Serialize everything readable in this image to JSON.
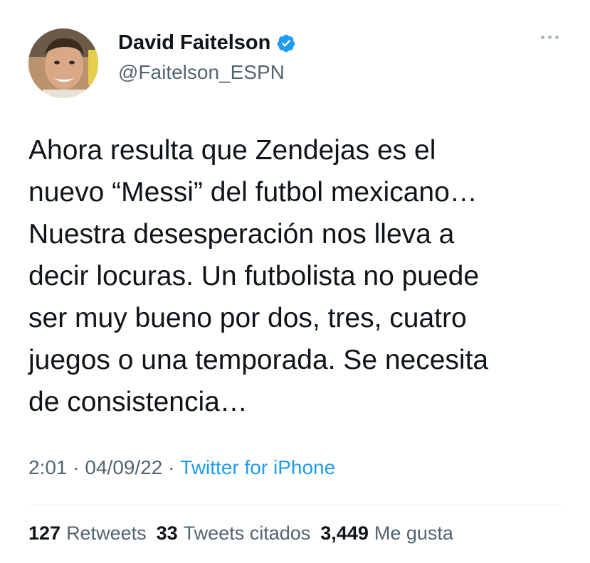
{
  "author": {
    "name": "David Faitelson",
    "handle": "@Faitelson_ESPN",
    "verified_icon": "verified-badge-icon"
  },
  "tweet": {
    "text": "Ahora resulta que Zendejas es el\nnuevo “Messi” del futbol mexicano…\nNuestra desesperación nos lleva a\ndecir locuras. Un futbolista no puede\nser muy bueno por dos, tres, cuatro\njuegos o una temporada. Se necesita\nde consistencia…",
    "time": "2:01",
    "date": "04/09/22",
    "separator": " · ",
    "source": "Twitter for iPhone"
  },
  "stats": {
    "retweets_count": "127",
    "retweets_label": "Retweets",
    "quotes_count": "33",
    "quotes_label": "Tweets citados",
    "likes_count": "3,449",
    "likes_label": "Me gusta"
  },
  "colors": {
    "text": "#0f1419",
    "secondary": "#536471",
    "accent": "#1d9bf0"
  }
}
